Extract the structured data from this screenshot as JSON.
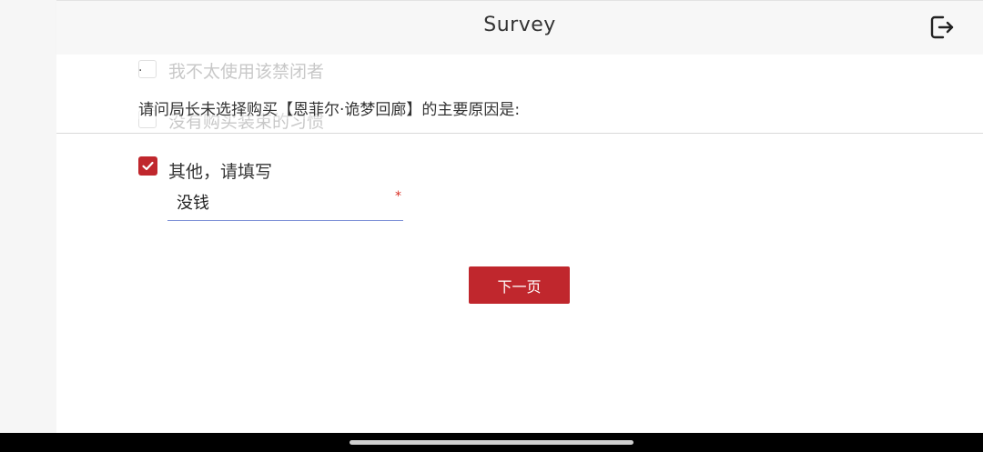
{
  "header": {
    "title": "Survey",
    "exit_icon": "logout-icon"
  },
  "background_options": [
    {
      "label": "我不太使用该禁闭者"
    },
    {
      "label": "没有购买装束的习惯"
    }
  ],
  "question": {
    "marker": "·",
    "text": "请问局长未选择购买【恩菲尔·诡梦回廊】的主要原因是:"
  },
  "other_option": {
    "label": "其他，请填写",
    "checked": true,
    "input_value": "没钱",
    "required_mark": "*"
  },
  "next_button": {
    "label": "下一页"
  },
  "colors": {
    "accent": "#c0272d",
    "input_underline": "#7b8fd6",
    "required": "#d93025"
  }
}
